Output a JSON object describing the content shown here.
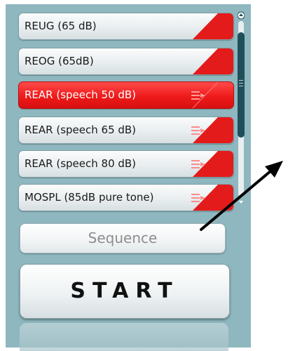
{
  "measurements": [
    {
      "label": "REUG (65 dB)",
      "selected": false,
      "has_list_icon": false
    },
    {
      "label": "REOG (65dB)",
      "selected": false,
      "has_list_icon": false
    },
    {
      "label": "REAR (speech 50 dB)",
      "selected": true,
      "has_list_icon": true
    },
    {
      "label": "REAR (speech 65 dB)",
      "selected": false,
      "has_list_icon": true
    },
    {
      "label": "REAR (speech 80 dB)",
      "selected": false,
      "has_list_icon": true
    },
    {
      "label": "MOSPL (85dB pure tone)",
      "selected": false,
      "has_list_icon": true
    }
  ],
  "buttons": {
    "sequence_label": "Sequence",
    "start_label": "START"
  },
  "colors": {
    "panel_bg": "#8fb7bf",
    "accent_red": "#e31b1b",
    "scroll_thumb": "#1f4f5a",
    "arrow": "#000000"
  }
}
